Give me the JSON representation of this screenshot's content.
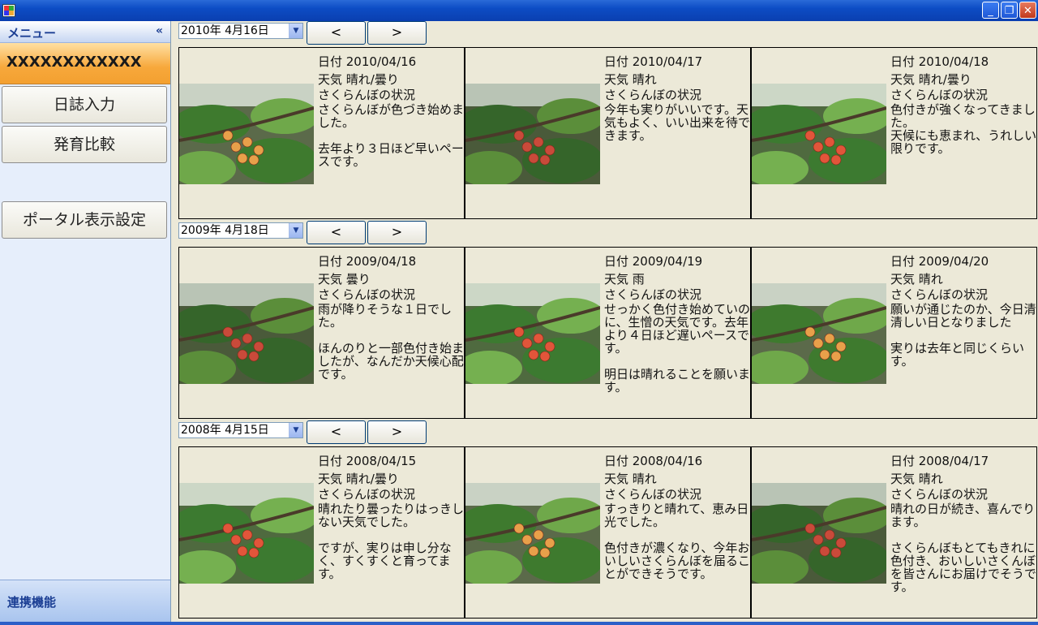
{
  "sidebar": {
    "title": "メニュー",
    "collapse_label": "«",
    "user_name": "XXXXXXXXXXXX",
    "buttons": [
      "日誌入力",
      "発育比較",
      "ポータル表示設定"
    ],
    "footer_label": "連携機能"
  },
  "nav": {
    "prev_label": "<",
    "next_label": ">",
    "dropdown_arrow": "▼"
  },
  "years": [
    {
      "selected_date": "2010年  4月16日",
      "entries": [
        {
          "date_label": "日付  2010/04/16",
          "weather_label": "天気  晴れ/曇り",
          "status_label": "さくらんぼの状況",
          "comment": "さくらんぼが色づき始めました。\n\n去年より３日ほど早いペースです。",
          "photo_icon": "cherry-photo"
        },
        {
          "date_label": "日付  2010/04/17",
          "weather_label": "天気  晴れ",
          "status_label": "さくらんぼの状況",
          "comment": "今年も実りがいいです。天気もよく、いい出来を待できます。",
          "photo_icon": "cherry-photo"
        },
        {
          "date_label": "日付  2010/04/18",
          "weather_label": "天気  晴れ/曇り",
          "status_label": "さくらんぼの状況",
          "comment": "色付きが強くなってきました。\n天候にも恵まれ、うれしい限りです。",
          "photo_icon": "cherry-photo"
        }
      ]
    },
    {
      "selected_date": "2009年  4月18日",
      "entries": [
        {
          "date_label": "日付  2009/04/18",
          "weather_label": "天気  曇り",
          "status_label": "さくらんぼの状況",
          "comment": "雨が降りそうな１日でした。\n\nほんのりと一部色付き始ましたが、なんだか天候心配です。",
          "photo_icon": "cherry-photo"
        },
        {
          "date_label": "日付  2009/04/19",
          "weather_label": "天気  雨",
          "status_label": "さくらんぼの状況",
          "comment": "せっかく色付き始めていのに、生憎の天気です。去年より４日ほど遅いペースです。\n\n明日は晴れることを願います。",
          "photo_icon": "cherry-photo"
        },
        {
          "date_label": "日付  2009/04/20",
          "weather_label": "天気  晴れ",
          "status_label": "さくらんぼの状況",
          "comment": "願いが通じたのか、今日清清しい日となりました\n\n実りは去年と同じくらいす。",
          "photo_icon": "cherry-photo"
        }
      ]
    },
    {
      "selected_date": "2008年  4月15日",
      "entries": [
        {
          "date_label": "日付  2008/04/15",
          "weather_label": "天気  晴れ/曇り",
          "status_label": "さくらんぼの状況",
          "comment": "晴れたり曇ったりはっきしない天気でした。\n\nですが、実りは申し分なく、すくすくと育ってます。",
          "photo_icon": "cherry-photo"
        },
        {
          "date_label": "日付  2008/04/16",
          "weather_label": "天気  晴れ",
          "status_label": "さくらんぼの状況",
          "comment": "すっきりと晴れて、恵み日光でした。\n\n色付きが濃くなり、今年おいしいさくらんぼを届ることができそうです。",
          "photo_icon": "cherry-photo"
        },
        {
          "date_label": "日付  2008/04/17",
          "weather_label": "天気  晴れ",
          "status_label": "さくらんぼの状況",
          "comment": "晴れの日が続き、喜んでります。\n\nさくらんぼもとてもきれに色付き、おいしいさくんぼを皆さんにお届けでそうです。",
          "photo_icon": "cherry-photo"
        }
      ]
    }
  ],
  "colors": {
    "window_bg": "#ece9d8",
    "title_bar": "#0d4cc4",
    "user_bar": "#f3a030",
    "sidebar_bg": "#e6eefb"
  }
}
